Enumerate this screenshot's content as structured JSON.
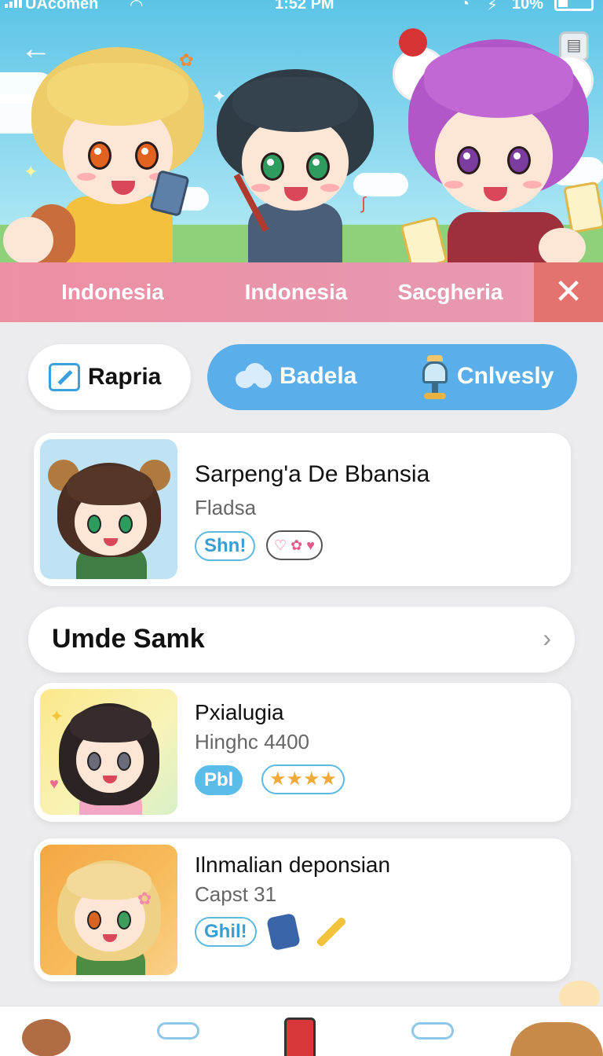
{
  "status_bar": {
    "carrier": "UAcomen",
    "time": "1:52 PM",
    "battery": "10%"
  },
  "header": {
    "back_icon": "arrow-left-icon",
    "menu_icon": "toaster-icon"
  },
  "tabs": [
    {
      "label": "Indonesia"
    },
    {
      "label": "Indonesia"
    },
    {
      "label": "Sacgheria"
    }
  ],
  "close_icon": "close-icon",
  "filters": {
    "left_label": "Rapria",
    "left_icon": "pencil-icon",
    "right_label_1": "Badela",
    "right_icon_1": "cloud-icon",
    "right_label_2": "Cnlvesly",
    "right_icon_2": "lamp-icon"
  },
  "cards": [
    {
      "title": "Sarpeng'a De Bbansia",
      "subtitle": "Fladsa",
      "tag": "Shn!"
    },
    {
      "title": "Pxialugia",
      "subtitle": "Hinghc 4400",
      "tag": "Pbl",
      "rating": "★★★★"
    },
    {
      "title": "Ilnmalian deponsian",
      "subtitle": "Capst 31",
      "tag": "Ghil!"
    }
  ],
  "section": {
    "label": "Umde Samk",
    "chevron": "›"
  },
  "colors": {
    "tabbar": "#ef8fa3",
    "close": "#e4726e",
    "accent_blue": "#5aaeea",
    "sky": "#5cc4e6"
  }
}
